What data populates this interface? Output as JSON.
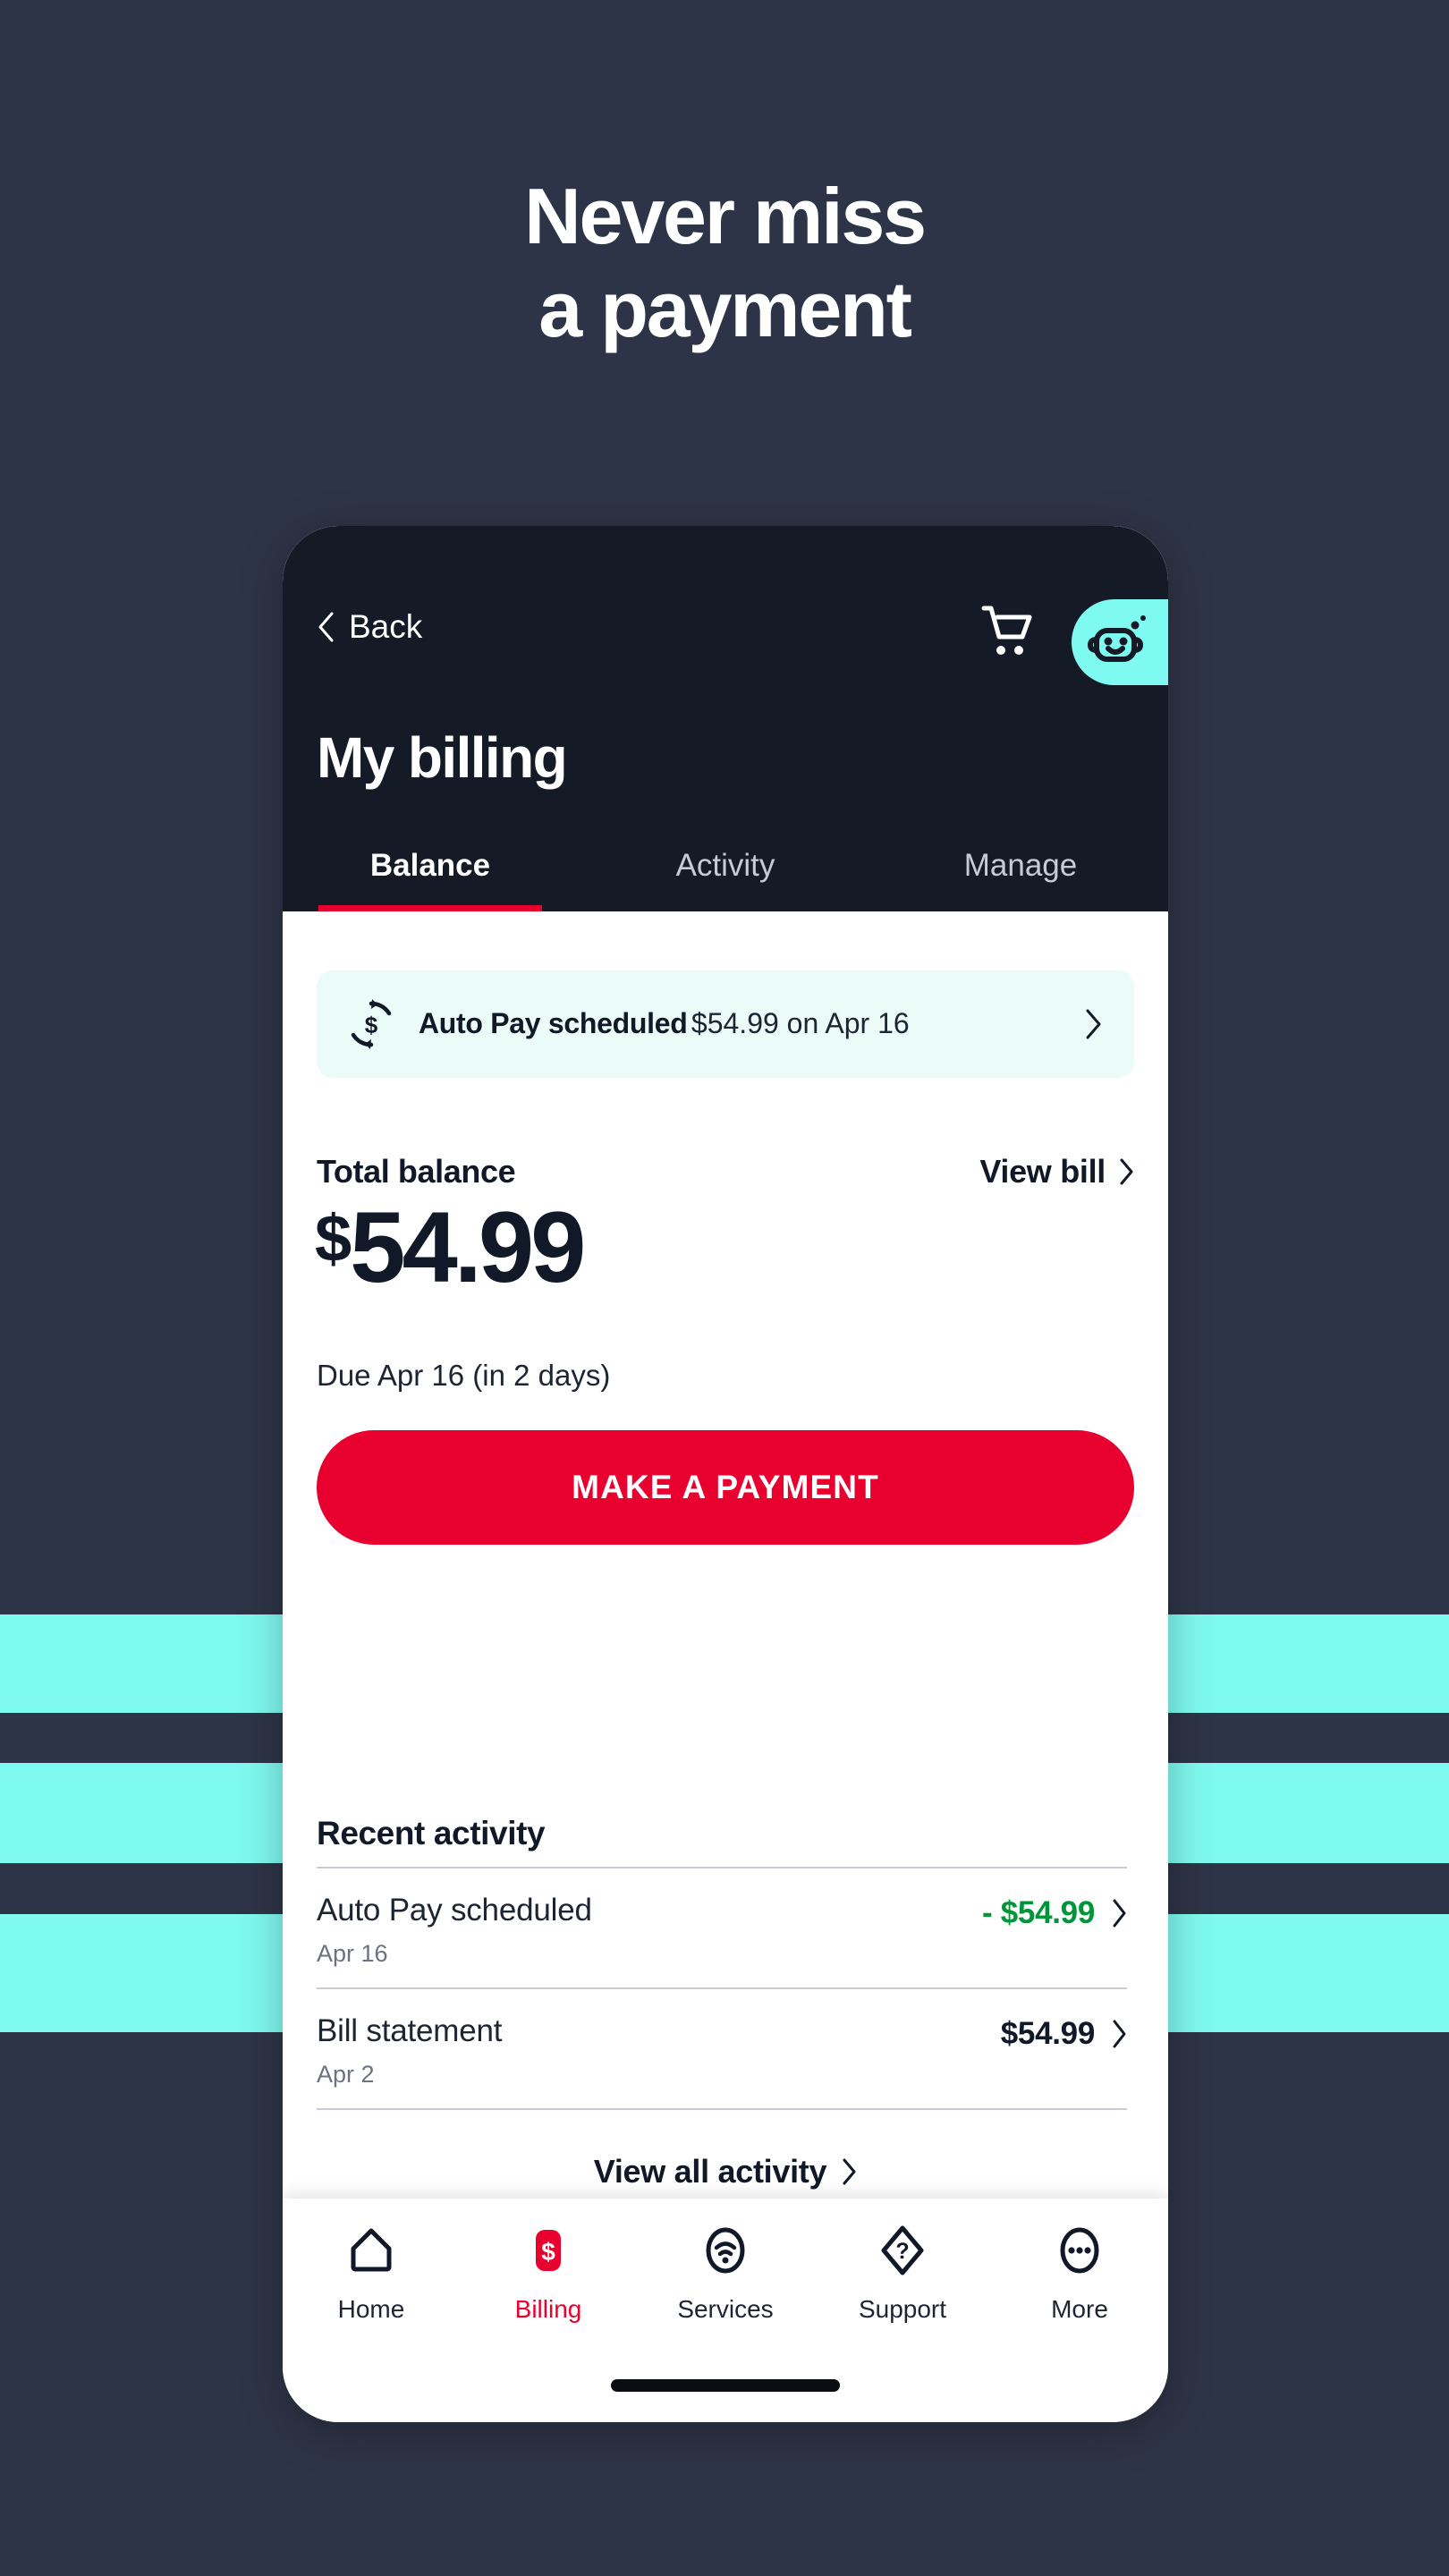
{
  "hero": {
    "line1": "Never miss",
    "line2": "a payment"
  },
  "colors": {
    "background": "#2e3447",
    "stripe": "#7ffaf0",
    "header": "#141a26",
    "accent_red": "#e8002e",
    "credit_green": "#00953b",
    "banner_bg": "#eafbf8"
  },
  "phone": {
    "header": {
      "back_label": "Back",
      "back_icon": "chevron-left-icon",
      "cart_icon": "shopping-cart-icon",
      "assistant_icon": "robot-assistant-icon",
      "title": "My billing",
      "tabs": [
        {
          "label": "Balance",
          "active": true
        },
        {
          "label": "Activity",
          "active": false
        },
        {
          "label": "Manage",
          "active": false
        }
      ]
    },
    "autopay_banner": {
      "icon": "autopay-dollar-refresh-icon",
      "title": "Auto Pay scheduled",
      "subtitle": "$54.99 on Apr 16",
      "chevron": "chevron-right-icon"
    },
    "balance": {
      "label": "Total balance",
      "view_bill_label": "View bill",
      "view_bill_chevron": "chevron-right-icon",
      "currency_symbol": "$",
      "amount": "54.99",
      "due_text": "Due Apr 16 (in 2 days)",
      "pay_button_label": "MAKE A PAYMENT"
    },
    "recent_activity": {
      "title": "Recent activity",
      "rows": [
        {
          "name": "Auto Pay scheduled",
          "date": "Apr 16",
          "amount": "- $54.99",
          "type": "credit",
          "chevron": "chevron-right-icon"
        },
        {
          "name": "Bill statement",
          "date": "Apr 2",
          "amount": "$54.99",
          "type": "charge",
          "chevron": "chevron-right-icon"
        }
      ],
      "view_all_label": "View all activity",
      "view_all_chevron": "chevron-right-icon"
    },
    "bottom_nav": [
      {
        "label": "Home",
        "icon": "home-icon",
        "active": false
      },
      {
        "label": "Billing",
        "icon": "billing-dollar-icon",
        "active": true
      },
      {
        "label": "Services",
        "icon": "services-wifi-icon",
        "active": false
      },
      {
        "label": "Support",
        "icon": "support-question-icon",
        "active": false
      },
      {
        "label": "More",
        "icon": "more-ellipsis-icon",
        "active": false
      }
    ]
  }
}
